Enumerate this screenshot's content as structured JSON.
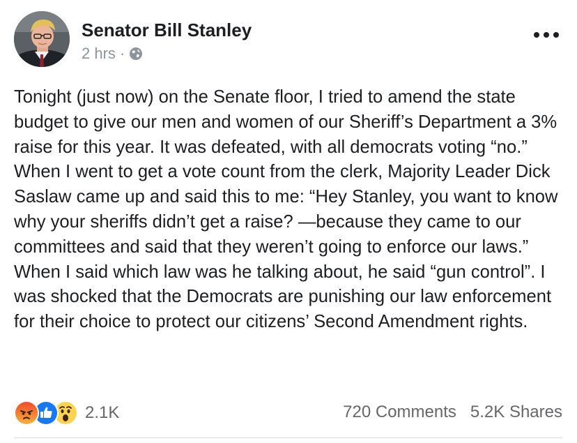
{
  "post": {
    "author": "Senator Bill Stanley",
    "time": "2 hrs",
    "separator": "·",
    "privacy_icon": "globe-icon",
    "more_icon": "more-options-icon",
    "text": "Tonight (just now) on the Senate floor, I tried to amend the state budget to give our men and women of our Sheriff’s Department a 3% raise for this year. It was defeated, with all democrats voting “no.” When I went to get a vote count from the clerk, Majority Leader Dick Saslaw came up and said this to me: “Hey Stanley, you want to know why your sheriffs didn’t get a raise? —because they came to our committees and said that they weren’t going to enforce our laws.” When I said which law was he talking about, he said “gun control”. I was shocked that the Democrats are punishing our law enforcement for their choice to protect our citizens’ Second Amendment rights."
  },
  "reactions": {
    "icons": [
      "angry-reaction-icon",
      "like-reaction-icon",
      "wow-reaction-icon"
    ],
    "count": "2.1K"
  },
  "stats": {
    "comments": "720 Comments",
    "shares": "5.2K Shares"
  },
  "colors": {
    "text": "#1c1e21",
    "secondary": "#65676b",
    "like_blue": "#1877f2",
    "angry_top": "#f04b2a",
    "wow_yellow": "#fcd350"
  }
}
